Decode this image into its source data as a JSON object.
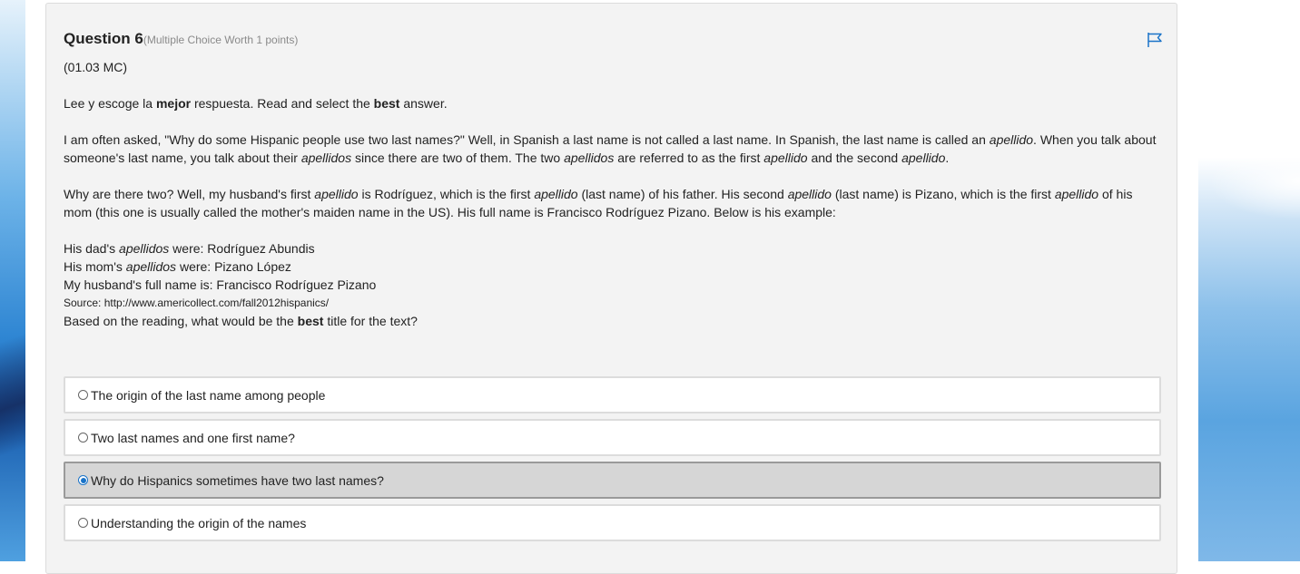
{
  "question": {
    "title": "Question 6",
    "meta": "(Multiple Choice Worth 1 points)",
    "code": "(01.03 MC)"
  },
  "instructions": {
    "p1": "Lee y escoge la ",
    "b1": "mejor",
    "p2": " respuesta. Read and select the ",
    "b2": "best",
    "p3": " answer."
  },
  "passage": {
    "para1": {
      "t1": "I am often asked, \"Why do some Hispanic people use two last names?\" Well, in Spanish a last name is not called a last name. In Spanish, the last name is called an ",
      "i1": "apellido",
      "t2": ". When you talk about someone's last name, you talk about their ",
      "i2": "apellidos",
      "t3": " since there are two of them. The two ",
      "i3": "apellidos",
      "t4": " are referred to as the first ",
      "i4": "apellido",
      "t5": " and the second ",
      "i5": "apellido",
      "t6": "."
    },
    "para2": {
      "t1": "Why are there two? Well, my husband's first ",
      "i1": "apellido",
      "t2": " is Rodríguez, which is the first ",
      "i2": "apellido",
      "t3": " (last name) of his father. His second ",
      "i3": "apellido",
      "t4": " (last name) is Pizano, which is the first ",
      "i4": "apellido",
      "t5": " of his mom (this one is usually called the mother's maiden name in the US). His full name is Francisco Rodríguez Pizano. Below is his example:"
    },
    "list": {
      "l1a": "His dad's ",
      "l1i": "apellidos",
      "l1b": " were: Rodríguez Abundis",
      "l2a": "His mom's ",
      "l2i": "apellidos",
      "l2b": " were: Pizano López",
      "l3": "My husband's full name is: Francisco Rodríguez Pizano"
    },
    "source": "Source: http://www.americollect.com/fall2012hispanics/"
  },
  "prompt": {
    "t1": "Based on the reading, what would be the ",
    "b1": "best",
    "t2": " title for the text?"
  },
  "options": [
    {
      "label": "The origin of the last name among people"
    },
    {
      "label": "Two last names and one first name?"
    },
    {
      "label": "Why do Hispanics sometimes have two last names?"
    },
    {
      "label": "Understanding the origin of the names"
    }
  ],
  "colors": {
    "accent": "#1a73c8",
    "card_bg": "#f3f3f3",
    "selected_bg": "#d6d6d6"
  },
  "icons": {
    "flag": "flag-icon"
  }
}
